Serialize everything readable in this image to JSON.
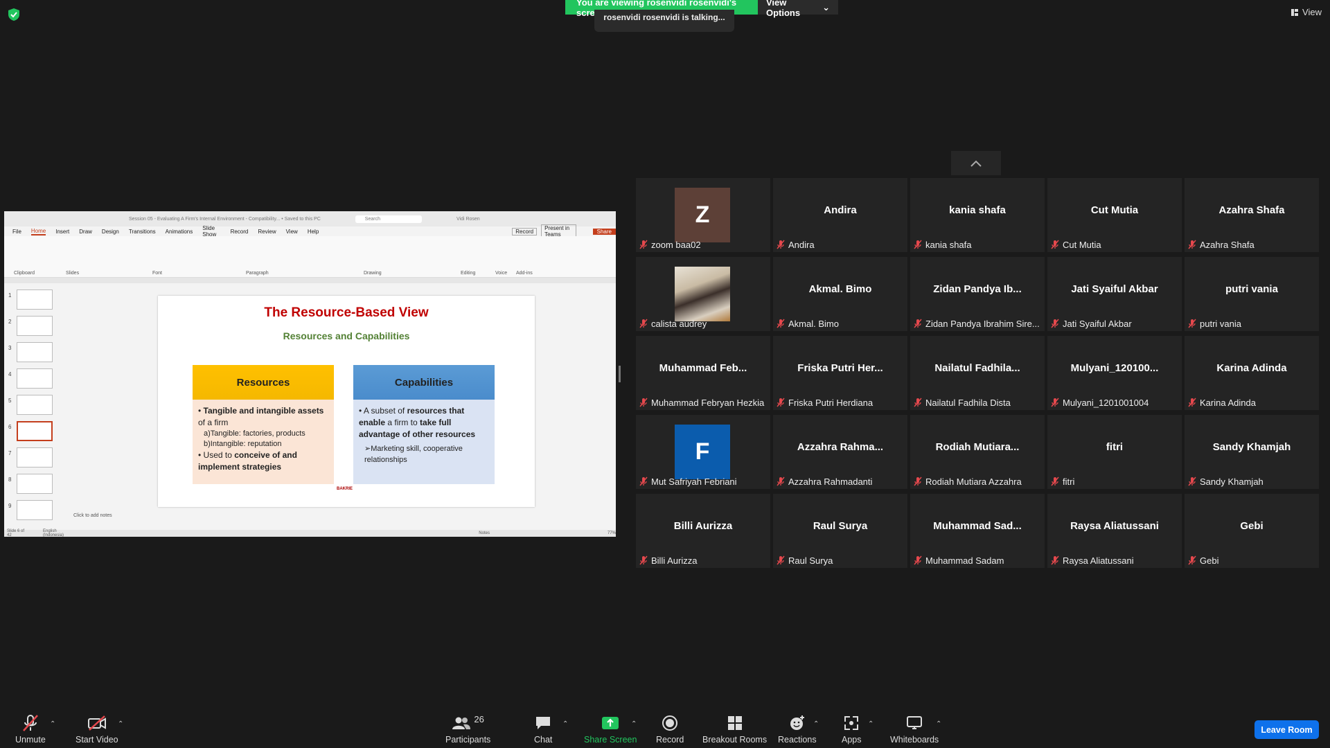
{
  "banner": {
    "viewing": "You are viewing rosenvidi rosenvidi's screen",
    "view_options": "View Options",
    "talking": "rosenvidi rosenvidi is talking..."
  },
  "top_right": {
    "view": "View"
  },
  "ppt": {
    "doc_title": "Session 05 - Evaluating A Firm's Internal Environment - Compatibility...  •  Saved to this PC",
    "search": "Search",
    "user": "Vidi Rosen",
    "menu": [
      "File",
      "Home",
      "Insert",
      "Draw",
      "Design",
      "Transitions",
      "Animations",
      "Slide Show",
      "Record",
      "Review",
      "View",
      "Help"
    ],
    "record_btn": "Record",
    "present_btn": "Present in Teams",
    "share_btn": "Share",
    "groups": [
      "Clipboard",
      "Slides",
      "Font",
      "Paragraph",
      "Drawing",
      "Editing",
      "Voice",
      "Add-ins"
    ],
    "notes": "Click to add notes",
    "status_slide": "Slide 6 of 42",
    "status_lang": "English (Indonesia)",
    "status_notes": "Notes",
    "zoom": "77%",
    "slide": {
      "title": "The Resource-Based View",
      "subtitle": "Resources and Capabilities",
      "res_head": "Resources",
      "res_b1a": "Tangible and intangible assets",
      "res_b1b": " of a firm",
      "res_a": "a)Tangible: factories, products",
      "res_b": "b)Intangible: reputation",
      "res_b2a": "Used to ",
      "res_b2b": "conceive of and implement strategies",
      "cap_head": "Capabilities",
      "cap_b1a": "A subset of ",
      "cap_b1b": "resources that enable",
      "cap_b1c": " a firm to ",
      "cap_b1d": "take full advantage of other resources",
      "cap_sub": "➢Marketing skill, cooperative relationships",
      "logo": "BAKRIE"
    },
    "thumb_nums": [
      "1",
      "2",
      "3",
      "4",
      "5",
      "6",
      "7",
      "8",
      "9"
    ]
  },
  "participants": [
    {
      "big": "",
      "avatar": "Z",
      "avatar_color": "#5d4037",
      "name": "zoom baa02"
    },
    {
      "big": "Andira",
      "name": "Andira"
    },
    {
      "big": "kania shafa",
      "name": "kania shafa"
    },
    {
      "big": "Cut Mutia",
      "name": "Cut Mutia"
    },
    {
      "big": "Azahra Shafa",
      "name": "Azahra Shafa"
    },
    {
      "big": "",
      "photo": true,
      "name": "calista audrey"
    },
    {
      "big": "Akmal. Bimo",
      "name": "Akmal. Bimo"
    },
    {
      "big": "Zidan  Pandya  Ib...",
      "name": "Zidan Pandya Ibrahim Sire..."
    },
    {
      "big": "Jati Syaiful Akbar",
      "name": "Jati Syaiful Akbar"
    },
    {
      "big": "putri vania",
      "name": "putri vania"
    },
    {
      "big": "Muhammad  Feb...",
      "name": "Muhammad Febryan Hezkia"
    },
    {
      "big": "Friska  Putri  Her...",
      "name": "Friska Putri Herdiana"
    },
    {
      "big": "Nailatul  Fadhila...",
      "name": "Nailatul Fadhila Dista"
    },
    {
      "big": "Mulyani_120100...",
      "name": "Mulyani_1201001004"
    },
    {
      "big": "Karina Adinda",
      "name": "Karina Adinda"
    },
    {
      "big": "",
      "avatar": "F",
      "avatar_color": "#0b5cad",
      "name": "Mut Safriyah Febriani"
    },
    {
      "big": "Azzahra  Rahma...",
      "name": "Azzahra Rahmadanti"
    },
    {
      "big": "Rodiah  Mutiara...",
      "name": "Rodiah Mutiara Azzahra"
    },
    {
      "big": "fitri",
      "name": "fitri"
    },
    {
      "big": "Sandy Khamjah",
      "name": "Sandy Khamjah"
    },
    {
      "big": "Billi Aurizza",
      "name": "Billi Aurizza"
    },
    {
      "big": "Raul Surya",
      "name": "Raul Surya"
    },
    {
      "big": "Muhammad  Sad...",
      "name": "Muhammad Sadam"
    },
    {
      "big": "Raysa Aliatussani",
      "name": "Raysa Aliatussani"
    },
    {
      "big": "Gebi",
      "name": "Gebi"
    }
  ],
  "toolbar": {
    "unmute": "Unmute",
    "start_video": "Start Video",
    "participants": "Participants",
    "participants_count": "26",
    "chat": "Chat",
    "share_screen": "Share Screen",
    "record": "Record",
    "breakout": "Breakout Rooms",
    "reactions": "Reactions",
    "apps": "Apps",
    "whiteboards": "Whiteboards",
    "leave": "Leave Room"
  },
  "colors": {
    "share_green": "#22c55e",
    "leave_blue": "#0e71eb",
    "muted_red": "#e5484d"
  }
}
